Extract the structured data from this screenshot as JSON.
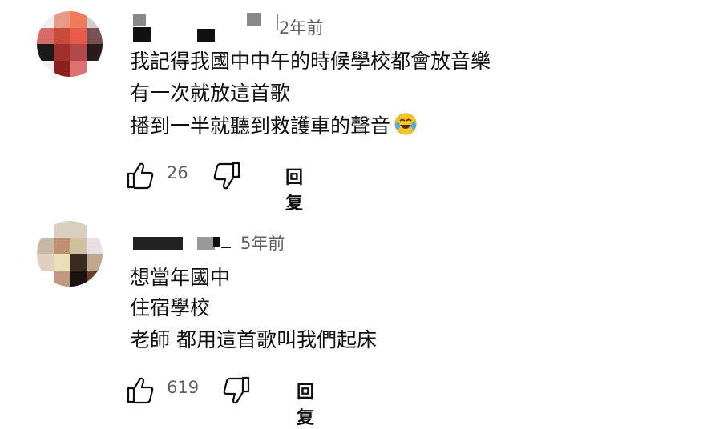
{
  "comments": [
    {
      "time": "2年前",
      "lines": [
        "我記得我國中中午的時候學校都會放音樂",
        "有一次就放這首歌",
        "播到一半就聽到救護車的聲音"
      ],
      "emoji": "laughing-tears-emoji",
      "likes": "26",
      "reply_label": "回复"
    },
    {
      "time": "5年前",
      "lines": [
        "想當年國中",
        "住宿學校",
        "老師 都用這首歌叫我們起床"
      ],
      "likes": "619",
      "reply_label": "回复"
    }
  ],
  "icons": {
    "like": "thumb-up-icon",
    "dislike": "thumb-down-icon"
  }
}
